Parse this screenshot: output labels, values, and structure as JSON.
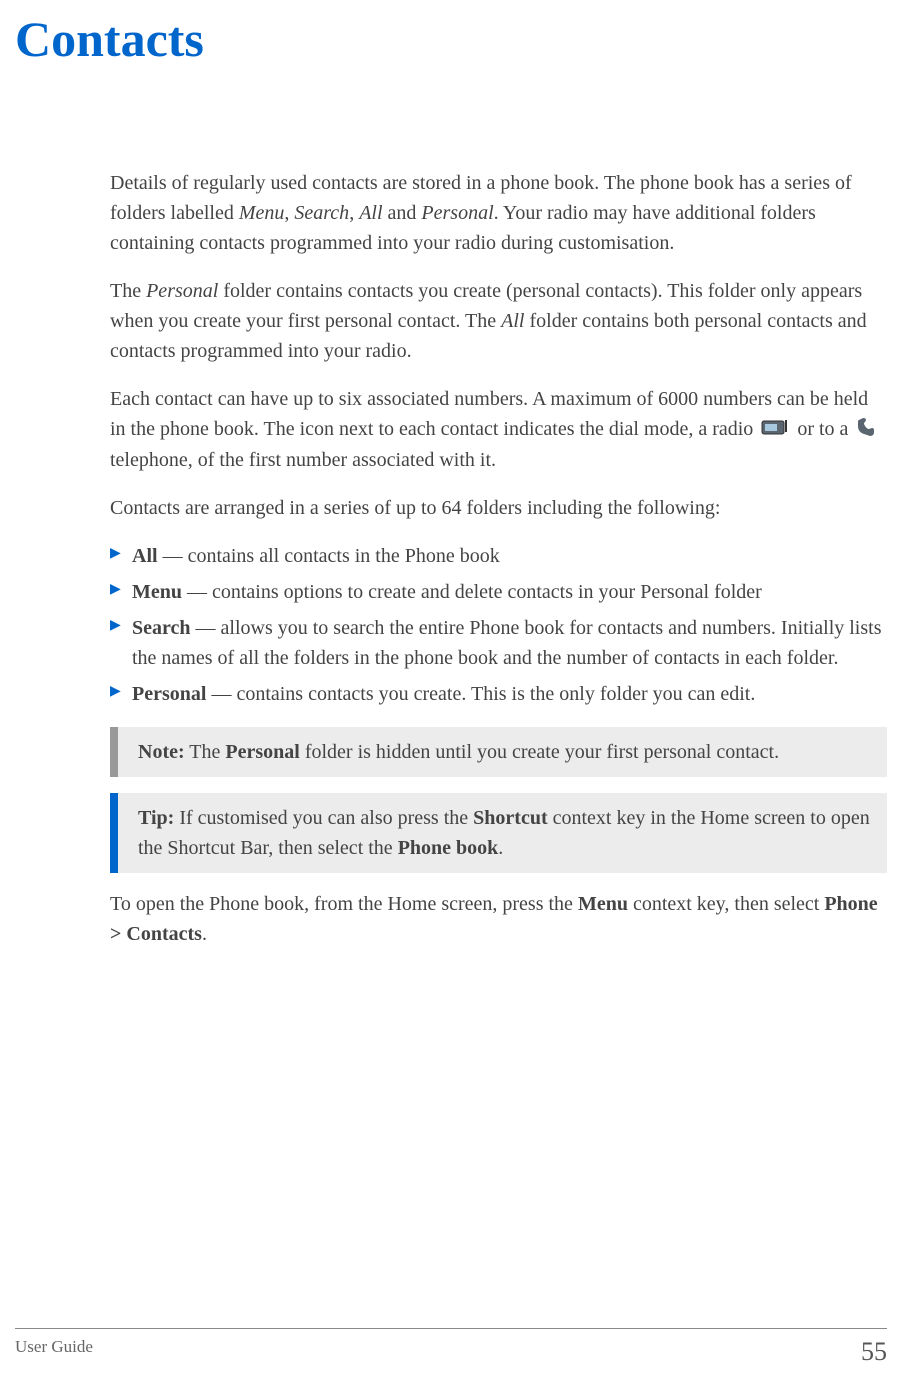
{
  "title": "Contacts",
  "paragraphs": {
    "p1_a": "Details of regularly used contacts are stored in a phone book. The phone book has a series of folders labelled ",
    "p1_menu": "Menu",
    "p1_comma1": ", ",
    "p1_search": "Search",
    "p1_comma2": ", ",
    "p1_all": "All",
    "p1_and": " and ",
    "p1_personal": "Personal",
    "p1_b": ". Your radio may have additional folders containing contacts programmed into your radio during customisation.",
    "p2_a": "The ",
    "p2_personal": "Personal",
    "p2_b": " folder contains contacts you create (personal contacts). This folder only appears when you create your first personal contact. The ",
    "p2_all": "All",
    "p2_c": " folder contains both personal contacts and contacts programmed into your radio.",
    "p3_a": "Each contact can have up to six associated numbers. A maximum of 6000 numbers can be held in the phone book. The icon next to each contact indicates the dial mode, a radio ",
    "p3_b": " or to a ",
    "p3_c": " telephone, of the first number associated with it.",
    "p4": "Contacts are arranged in a series of up to 64 folders including the following:",
    "p5_a": "To open the Phone book, from the Home screen, press the ",
    "p5_menu": "Menu",
    "p5_b": " context key, then select ",
    "p5_path": "Phone > Contacts",
    "p5_c": "."
  },
  "list": [
    {
      "label": "All",
      "desc": " — contains all contacts in the Phone book"
    },
    {
      "label": "Menu",
      "desc": " — contains options to create and delete contacts in your Personal folder"
    },
    {
      "label": "Search",
      "desc": " — allows you to search the entire Phone book for contacts and numbers. Initially lists the names of all the folders in the phone book and the number of contacts in each folder."
    },
    {
      "label": "Personal",
      "desc": " — contains contacts you create. This is the only folder you can edit."
    }
  ],
  "note": {
    "label": "Note:",
    "text_a": "  The ",
    "bold1": "Personal",
    "text_b": " folder is hidden until you create your first personal contact."
  },
  "tip": {
    "label": "Tip:",
    "text_a": "  If customised you can also press the ",
    "bold1": "Shortcut",
    "text_b": " context key in the Home screen to open the Shortcut Bar, then select the ",
    "bold2": "Phone book",
    "text_c": "."
  },
  "footer": {
    "left": "User Guide",
    "page": "55"
  }
}
